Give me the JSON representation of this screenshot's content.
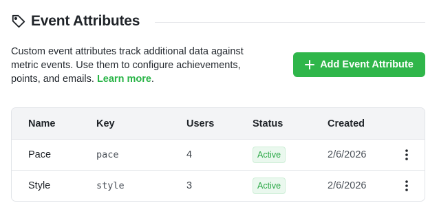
{
  "header": {
    "title": "Event Attributes"
  },
  "description": {
    "text": "Custom event attributes track additional data against metric events. Use them to configure achievements, points, and emails. ",
    "link_label": "Learn more",
    "suffix": "."
  },
  "actions": {
    "add_label": "Add Event Attribute"
  },
  "table": {
    "columns": [
      "Name",
      "Key",
      "Users",
      "Status",
      "Created"
    ],
    "rows": [
      {
        "name": "Pace",
        "key": "pace",
        "users": "4",
        "status": "Active",
        "created": "2/6/2026"
      },
      {
        "name": "Style",
        "key": "style",
        "users": "3",
        "status": "Active",
        "created": "2/6/2026"
      }
    ]
  },
  "colors": {
    "accent": "#2fb64a",
    "status_active": "#2aa745"
  },
  "icons": {
    "header": "tag-icon",
    "add": "plus-icon",
    "row_menu": "more-vertical-icon"
  }
}
